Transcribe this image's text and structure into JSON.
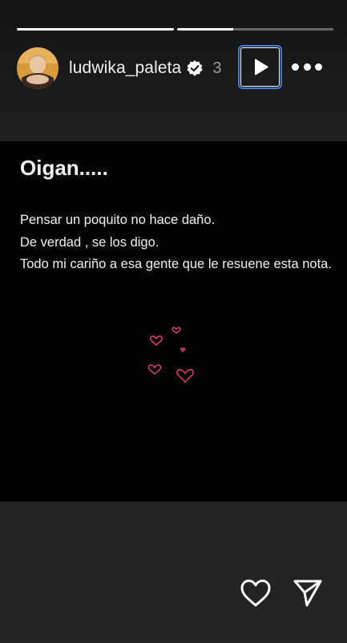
{
  "story": {
    "progress": [
      1.0,
      0.36
    ],
    "header": {
      "avatar_icon": "user-avatar",
      "username": "ludwika_paleta",
      "verified_icon": "verified-badge-icon",
      "time": "3",
      "play_icon": "play-icon",
      "more_icon": "more-options-icon"
    },
    "content": {
      "title": "Oigan.....",
      "lines": [
        "Pensar un poquito no hace daño.",
        "De verdad , se los digo.",
        "Todo mi cariño a esa gente que le resuene esta nota."
      ],
      "sticker_icon": "hearts-sticker",
      "heart_color": "#e8476a"
    },
    "footer": {
      "like_icon": "heart-outline-icon",
      "share_icon": "send-icon"
    }
  }
}
